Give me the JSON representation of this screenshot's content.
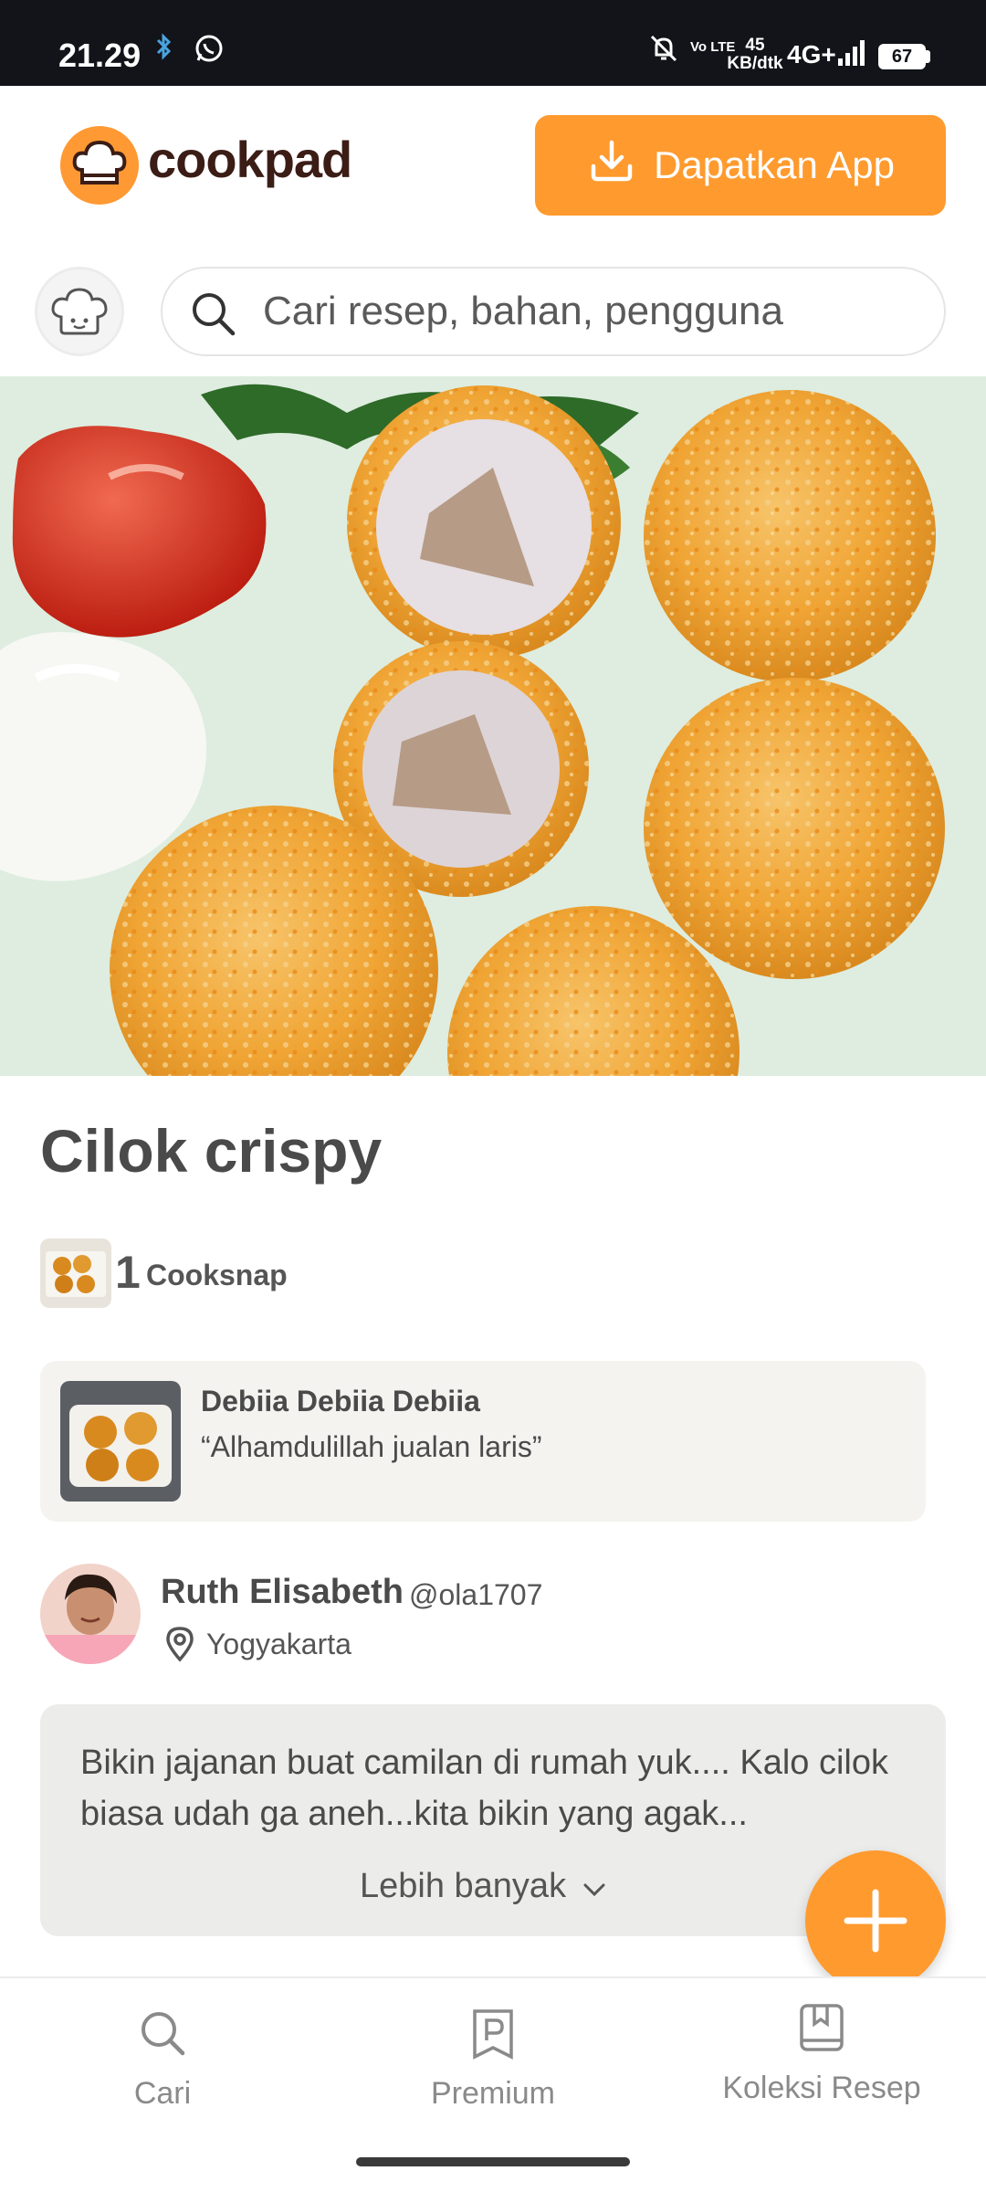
{
  "status_bar": {
    "time": "21.29",
    "net_speed_value": "45",
    "net_speed_unit": "KB/dtk",
    "network": "4G+",
    "volte": "Vo LTE",
    "battery": "67",
    "icons": [
      "bluetooth-icon",
      "whatsapp-icon",
      "mute-bell-icon",
      "volte-icon",
      "signal-icon",
      "battery-icon"
    ]
  },
  "header": {
    "logo_text": "cookpad",
    "get_app_label": "Dapatkan App",
    "brand_color": "#ff9a2e"
  },
  "search": {
    "placeholder": "Cari resep, bahan, pengguna"
  },
  "recipe": {
    "title": "Cilok crispy",
    "cooksnap_count": "1",
    "cooksnap_label": "Cooksnap"
  },
  "cooksnap_card": {
    "author": "Debiia Debiia Debiia",
    "text": "“Alhamdulillah jualan laris”"
  },
  "author": {
    "name": "Ruth Elisabeth",
    "handle": "@ola1707",
    "location": "Yogyakarta"
  },
  "description": {
    "text": "Bikin jajanan buat camilan di rumah yuk.... Kalo cilok biasa udah ga aneh...kita bikin yang agak...",
    "more_label": "Lebih banyak"
  },
  "bottom_nav": {
    "items": [
      {
        "label": "Cari",
        "icon": "search-icon"
      },
      {
        "label": "Premium",
        "icon": "premium-icon"
      },
      {
        "label": "Koleksi Resep",
        "icon": "bookmark-collection-icon"
      }
    ]
  }
}
